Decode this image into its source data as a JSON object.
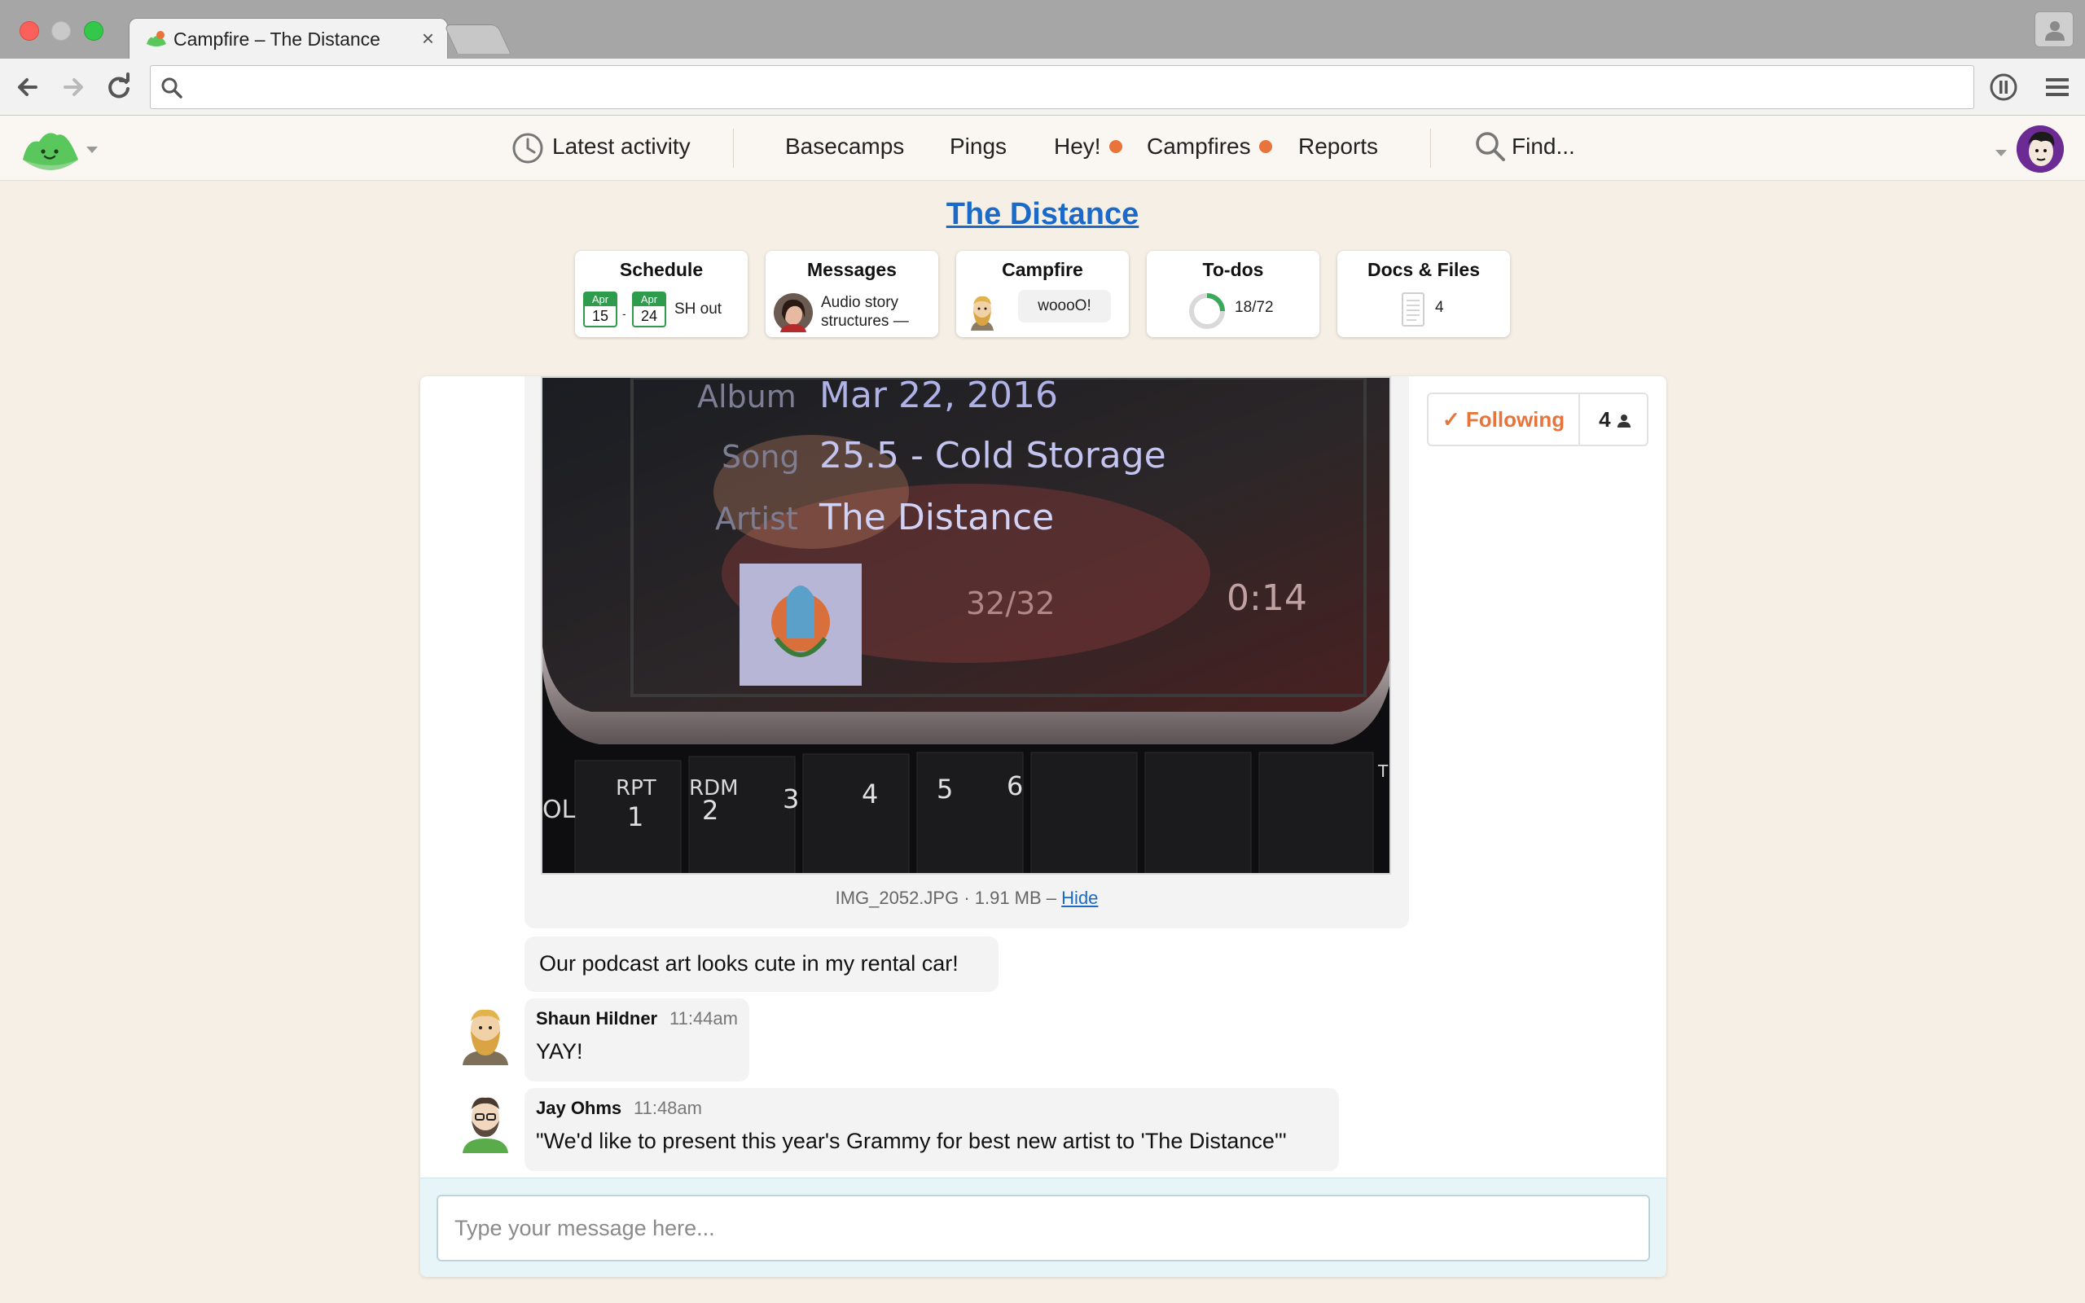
{
  "browser": {
    "tab_title": "Campfire – The Distance",
    "tab_close": "×",
    "url": ""
  },
  "nav": {
    "latest_activity": "Latest activity",
    "basecamps": "Basecamps",
    "pings": "Pings",
    "hey": "Hey!",
    "campfires": "Campfires",
    "reports": "Reports",
    "find": "Find...",
    "badge_color": "#e8743b"
  },
  "project": {
    "title": "The Distance"
  },
  "tools": {
    "schedule": {
      "label": "Schedule",
      "start_month": "Apr",
      "start_day": "15",
      "end_month": "Apr",
      "end_day": "24",
      "dash": "-",
      "event": "SH out"
    },
    "messages": {
      "label": "Messages",
      "preview_line1": "Audio story",
      "preview_line2": "structures —"
    },
    "campfire": {
      "label": "Campfire",
      "preview": "woooO!"
    },
    "todos": {
      "label": "To-dos",
      "progress_text": "18/72",
      "completed": 18,
      "total": 72
    },
    "docs": {
      "label": "Docs & Files",
      "count": "4"
    }
  },
  "following": {
    "label": "✓ Following",
    "count": "4"
  },
  "photo": {
    "album_label": "Album",
    "album_value": "Mar 22, 2016",
    "song_label": "Song",
    "song_value": "25.5 - Cold Storage",
    "artist_label": "Artist",
    "artist_value": "The Distance",
    "track": "32/32",
    "time": "0:14",
    "buttons": [
      "1",
      "2",
      "3",
      "4",
      "5",
      "6"
    ],
    "button_sub": [
      "RPT",
      "RDM"
    ],
    "edge_left": "OL",
    "edge_right": "T S"
  },
  "image_meta": {
    "filename": "IMG_2052.JPG · 1.91 MB –",
    "hide_link": "Hide"
  },
  "messages": [
    {
      "text": "Our podcast art looks cute in my rental car!"
    },
    {
      "author": "Shaun Hildner",
      "time": "11:44am",
      "text": "YAY!"
    },
    {
      "author": "Jay Ohms",
      "time": "11:48am",
      "text": "\"We'd like to present this year's Grammy for best new artist to 'The Distance'\""
    }
  ],
  "composer": {
    "placeholder": "Type your message here..."
  }
}
